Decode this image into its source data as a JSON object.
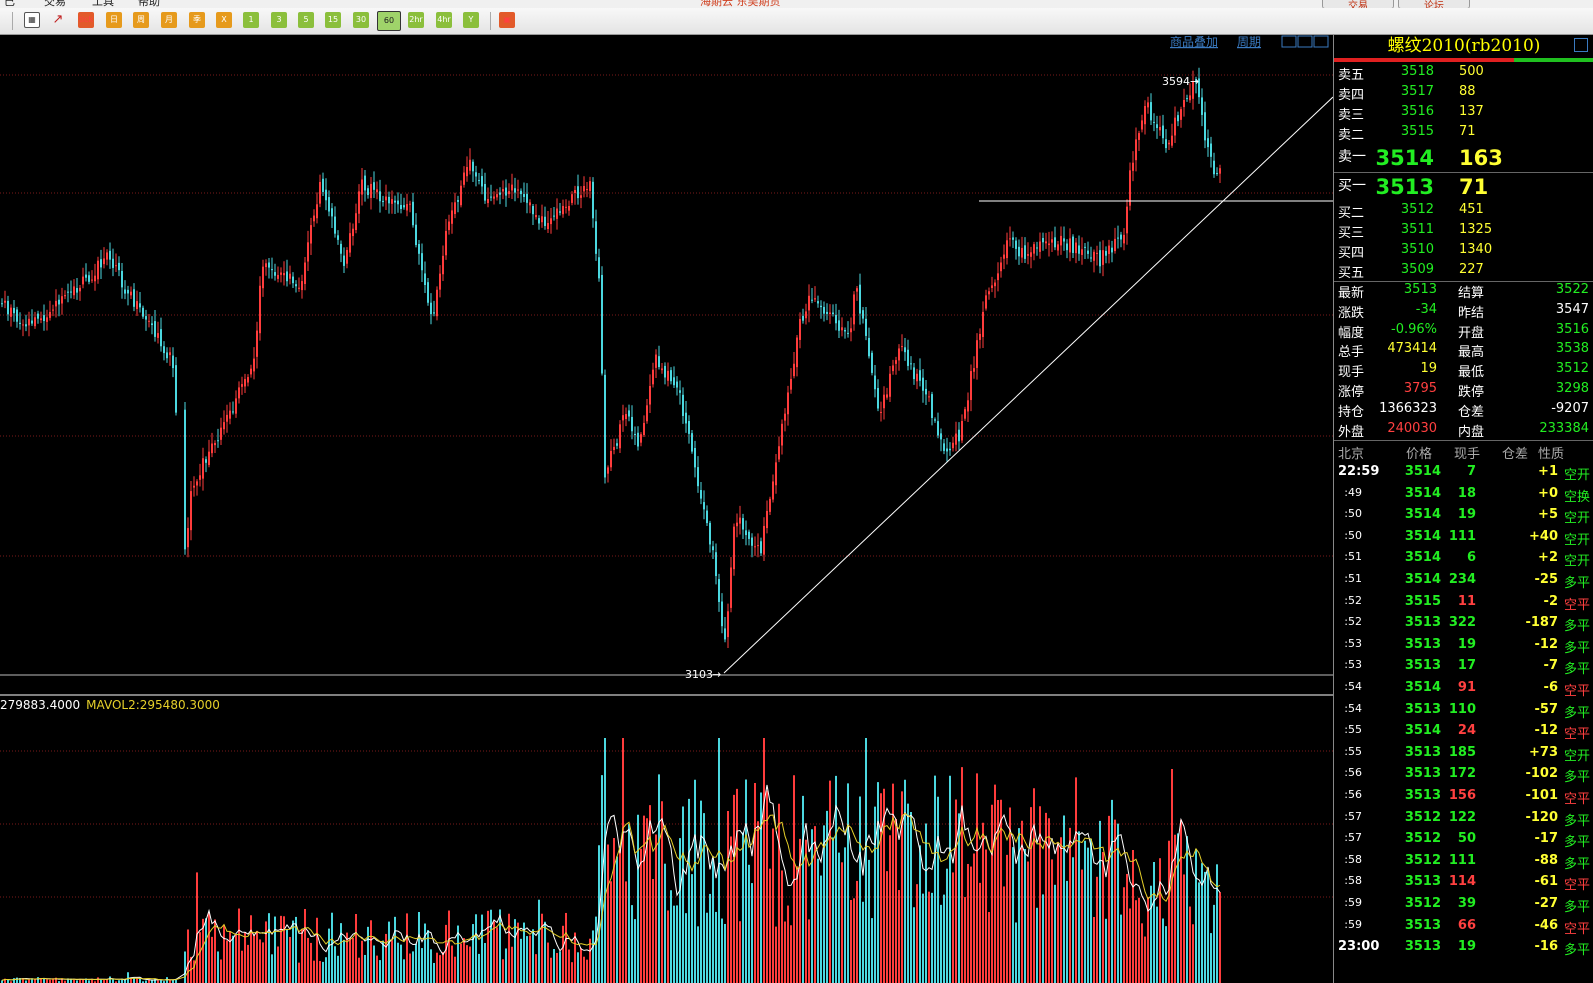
{
  "menu": {
    "items": [
      "已",
      "交易",
      "工具",
      "帮助"
    ],
    "title": "海期云 东吴期货",
    "btn_trade": "交易",
    "btn_forum": "论坛"
  },
  "toolbar": {
    "buttons": [
      "tick",
      "日",
      "周",
      "月",
      "季",
      "X",
      "1",
      "3",
      "5",
      "15",
      "30",
      "60",
      "2hr",
      "4hr",
      "Y"
    ],
    "selected": "60"
  },
  "chart": {
    "top_links": {
      "overlay": "商品叠加",
      "period": "周期"
    },
    "high_label": "3594",
    "low_label": "3103",
    "volume_legend": {
      "mavol1": "279883.4000",
      "mavol2_label": "MAVOL2:",
      "mavol2": "295480.3000"
    },
    "colors": {
      "up": "#ff3c3c",
      "down": "#4bd8e0",
      "grid": "#7a1a1a",
      "mavol1": "#ffffff",
      "mavol2": "#e6d02a"
    }
  },
  "chart_data": {
    "type": "candlestick",
    "instrument": "rb2010",
    "price_range": [
      3103,
      3594
    ],
    "marked_high": 3594,
    "marked_low": 3103
  },
  "panel": {
    "title": "螺纹2010(rb2010)",
    "asks": [
      {
        "label": "卖五",
        "price": "3518",
        "vol": "500"
      },
      {
        "label": "卖四",
        "price": "3517",
        "vol": "88"
      },
      {
        "label": "卖三",
        "price": "3516",
        "vol": "137"
      },
      {
        "label": "卖二",
        "price": "3515",
        "vol": "71"
      },
      {
        "label": "卖一",
        "price": "3514",
        "vol": "163"
      }
    ],
    "bids": [
      {
        "label": "买一",
        "price": "3513",
        "vol": "71"
      },
      {
        "label": "买二",
        "price": "3512",
        "vol": "451"
      },
      {
        "label": "买三",
        "price": "3511",
        "vol": "1325"
      },
      {
        "label": "买四",
        "price": "3510",
        "vol": "1340"
      },
      {
        "label": "买五",
        "price": "3509",
        "vol": "227"
      }
    ],
    "stats": [
      {
        "l1": "最新",
        "v1": "3513",
        "c1": "grn",
        "l2": "结算",
        "v2": "3522",
        "c2": "grn"
      },
      {
        "l1": "涨跌",
        "v1": "-34",
        "c1": "grn",
        "l2": "昨结",
        "v2": "3547",
        "c2": "wht"
      },
      {
        "l1": "幅度",
        "v1": "-0.96%",
        "c1": "grn",
        "l2": "开盘",
        "v2": "3516",
        "c2": "grn"
      },
      {
        "l1": "总手",
        "v1": "473414",
        "c1": "yel",
        "l2": "最高",
        "v2": "3538",
        "c2": "grn"
      },
      {
        "l1": "现手",
        "v1": "19",
        "c1": "yel",
        "l2": "最低",
        "v2": "3512",
        "c2": "grn"
      },
      {
        "l1": "涨停",
        "v1": "3795",
        "c1": "red",
        "l2": "跌停",
        "v2": "3298",
        "c2": "grn"
      },
      {
        "l1": "持仓",
        "v1": "1366323",
        "c1": "wht",
        "l2": "仓差",
        "v2": "-9207",
        "c2": "wht"
      },
      {
        "l1": "外盘",
        "v1": "240030",
        "c1": "red",
        "l2": "内盘",
        "v2": "233384",
        "c2": "grn"
      }
    ],
    "tick_header": [
      "北京",
      "价格",
      "现手",
      "仓差",
      "性质"
    ],
    "ticks": [
      {
        "t": "22:59",
        "p": "3514",
        "pc": "grn",
        "v": "7",
        "vc": "grn",
        "d": "+1",
        "dc": "yel",
        "n": "空开",
        "nc": "grn"
      },
      {
        "t": ":49",
        "p": "3514",
        "pc": "grn",
        "v": "18",
        "vc": "grn",
        "d": "+0",
        "dc": "yel",
        "n": "空换",
        "nc": "grn"
      },
      {
        "t": ":50",
        "p": "3514",
        "pc": "grn",
        "v": "19",
        "vc": "grn",
        "d": "+5",
        "dc": "yel",
        "n": "空开",
        "nc": "grn"
      },
      {
        "t": ":50",
        "p": "3514",
        "pc": "grn",
        "v": "111",
        "vc": "grn",
        "d": "+40",
        "dc": "yel",
        "n": "空开",
        "nc": "grn"
      },
      {
        "t": ":51",
        "p": "3514",
        "pc": "grn",
        "v": "6",
        "vc": "grn",
        "d": "+2",
        "dc": "yel",
        "n": "空开",
        "nc": "grn"
      },
      {
        "t": ":51",
        "p": "3514",
        "pc": "grn",
        "v": "234",
        "vc": "grn",
        "d": "-25",
        "dc": "yel",
        "n": "多平",
        "nc": "grn"
      },
      {
        "t": ":52",
        "p": "3515",
        "pc": "grn",
        "v": "11",
        "vc": "red",
        "d": "-2",
        "dc": "yel",
        "n": "空平",
        "nc": "red"
      },
      {
        "t": ":52",
        "p": "3513",
        "pc": "grn",
        "v": "322",
        "vc": "grn",
        "d": "-187",
        "dc": "yel",
        "n": "多平",
        "nc": "grn"
      },
      {
        "t": ":53",
        "p": "3513",
        "pc": "grn",
        "v": "19",
        "vc": "grn",
        "d": "-12",
        "dc": "yel",
        "n": "多平",
        "nc": "grn"
      },
      {
        "t": ":53",
        "p": "3513",
        "pc": "grn",
        "v": "17",
        "vc": "grn",
        "d": "-7",
        "dc": "yel",
        "n": "多平",
        "nc": "grn"
      },
      {
        "t": ":54",
        "p": "3514",
        "pc": "grn",
        "v": "91",
        "vc": "red",
        "d": "-6",
        "dc": "yel",
        "n": "空平",
        "nc": "red"
      },
      {
        "t": ":54",
        "p": "3513",
        "pc": "grn",
        "v": "110",
        "vc": "grn",
        "d": "-57",
        "dc": "yel",
        "n": "多平",
        "nc": "grn"
      },
      {
        "t": ":55",
        "p": "3514",
        "pc": "grn",
        "v": "24",
        "vc": "red",
        "d": "-12",
        "dc": "yel",
        "n": "空平",
        "nc": "red"
      },
      {
        "t": ":55",
        "p": "3513",
        "pc": "grn",
        "v": "185",
        "vc": "grn",
        "d": "+73",
        "dc": "yel",
        "n": "空开",
        "nc": "grn"
      },
      {
        "t": ":56",
        "p": "3513",
        "pc": "grn",
        "v": "172",
        "vc": "grn",
        "d": "-102",
        "dc": "yel",
        "n": "多平",
        "nc": "grn"
      },
      {
        "t": ":56",
        "p": "3513",
        "pc": "grn",
        "v": "156",
        "vc": "red",
        "d": "-101",
        "dc": "yel",
        "n": "空平",
        "nc": "red"
      },
      {
        "t": ":57",
        "p": "3512",
        "pc": "grn",
        "v": "122",
        "vc": "grn",
        "d": "-120",
        "dc": "yel",
        "n": "多平",
        "nc": "grn"
      },
      {
        "t": ":57",
        "p": "3512",
        "pc": "grn",
        "v": "50",
        "vc": "grn",
        "d": "-17",
        "dc": "yel",
        "n": "多平",
        "nc": "grn"
      },
      {
        "t": ":58",
        "p": "3512",
        "pc": "grn",
        "v": "111",
        "vc": "grn",
        "d": "-88",
        "dc": "yel",
        "n": "多平",
        "nc": "grn"
      },
      {
        "t": ":58",
        "p": "3513",
        "pc": "grn",
        "v": "114",
        "vc": "red",
        "d": "-61",
        "dc": "yel",
        "n": "空平",
        "nc": "red"
      },
      {
        "t": ":59",
        "p": "3512",
        "pc": "grn",
        "v": "39",
        "vc": "grn",
        "d": "-27",
        "dc": "yel",
        "n": "多平",
        "nc": "grn"
      },
      {
        "t": ":59",
        "p": "3513",
        "pc": "grn",
        "v": "66",
        "vc": "red",
        "d": "-46",
        "dc": "yel",
        "n": "空平",
        "nc": "red"
      },
      {
        "t": "23:00",
        "p": "3513",
        "pc": "grn",
        "v": "19",
        "vc": "grn",
        "d": "-16",
        "dc": "yel",
        "n": "多平",
        "nc": "grn"
      }
    ]
  }
}
